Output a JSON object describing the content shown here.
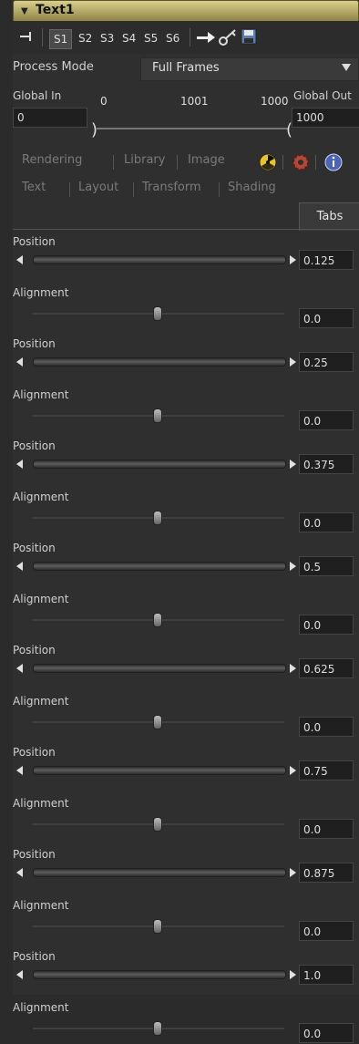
{
  "tool": {
    "title": "Text1"
  },
  "toolbar": {
    "slots": [
      "S1",
      "S2",
      "S3",
      "S4",
      "S5",
      "S6"
    ],
    "active_slot": "S1"
  },
  "process_mode": {
    "label": "Process Mode",
    "value": "Full Frames"
  },
  "global_range": {
    "in_label": "Global In",
    "out_label": "Global Out",
    "in_value": "0",
    "out_value": "1000",
    "scale_left": "0",
    "scale_mid": "1001",
    "scale_right": "1000"
  },
  "tabs_row1": [
    "Rendering",
    "Library",
    "Image"
  ],
  "tabs_row2": [
    "Text",
    "Layout",
    "Transform",
    "Shading"
  ],
  "active_tab": "Tabs",
  "controls": [
    {
      "label": "Position",
      "value": "0.125"
    },
    {
      "label": "Alignment",
      "value": "0.0"
    },
    {
      "label": "Position",
      "value": "0.25"
    },
    {
      "label": "Alignment",
      "value": "0.0"
    },
    {
      "label": "Position",
      "value": "0.375"
    },
    {
      "label": "Alignment",
      "value": "0.0"
    },
    {
      "label": "Position",
      "value": "0.5"
    },
    {
      "label": "Alignment",
      "value": "0.0"
    },
    {
      "label": "Position",
      "value": "0.625"
    },
    {
      "label": "Alignment",
      "value": "0.0"
    },
    {
      "label": "Position",
      "value": "0.75"
    },
    {
      "label": "Alignment",
      "value": "0.0"
    },
    {
      "label": "Position",
      "value": "0.875"
    },
    {
      "label": "Alignment",
      "value": "0.0"
    },
    {
      "label": "Position",
      "value": "1.0"
    },
    {
      "label": "Alignment",
      "value": "0.0"
    }
  ],
  "colors": {
    "title_gradient_top": "#d9cf8a",
    "title_gradient_bottom": "#8f8446",
    "panel_bg": "#2f2f2f",
    "field_bg": "#1f1f1f"
  }
}
